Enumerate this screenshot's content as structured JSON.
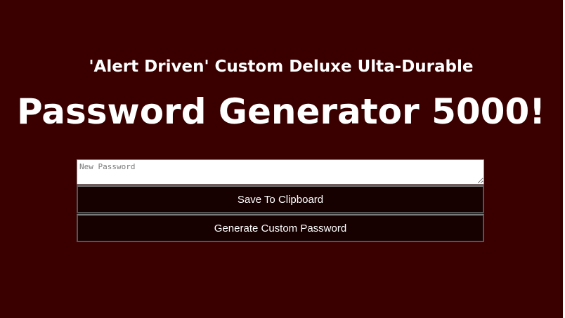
{
  "page": {
    "subtitle": "'Alert Driven' Custom Deluxe Ulta-Durable",
    "title": "Password Generator 5000!"
  },
  "form": {
    "password_placeholder": "New Password",
    "password_value": "",
    "save_label": "Save To Clipboard",
    "generate_label": "Generate Custom Password"
  },
  "colors": {
    "background": "#3a0000",
    "button_bg": "#160000",
    "text": "#ffffff"
  }
}
